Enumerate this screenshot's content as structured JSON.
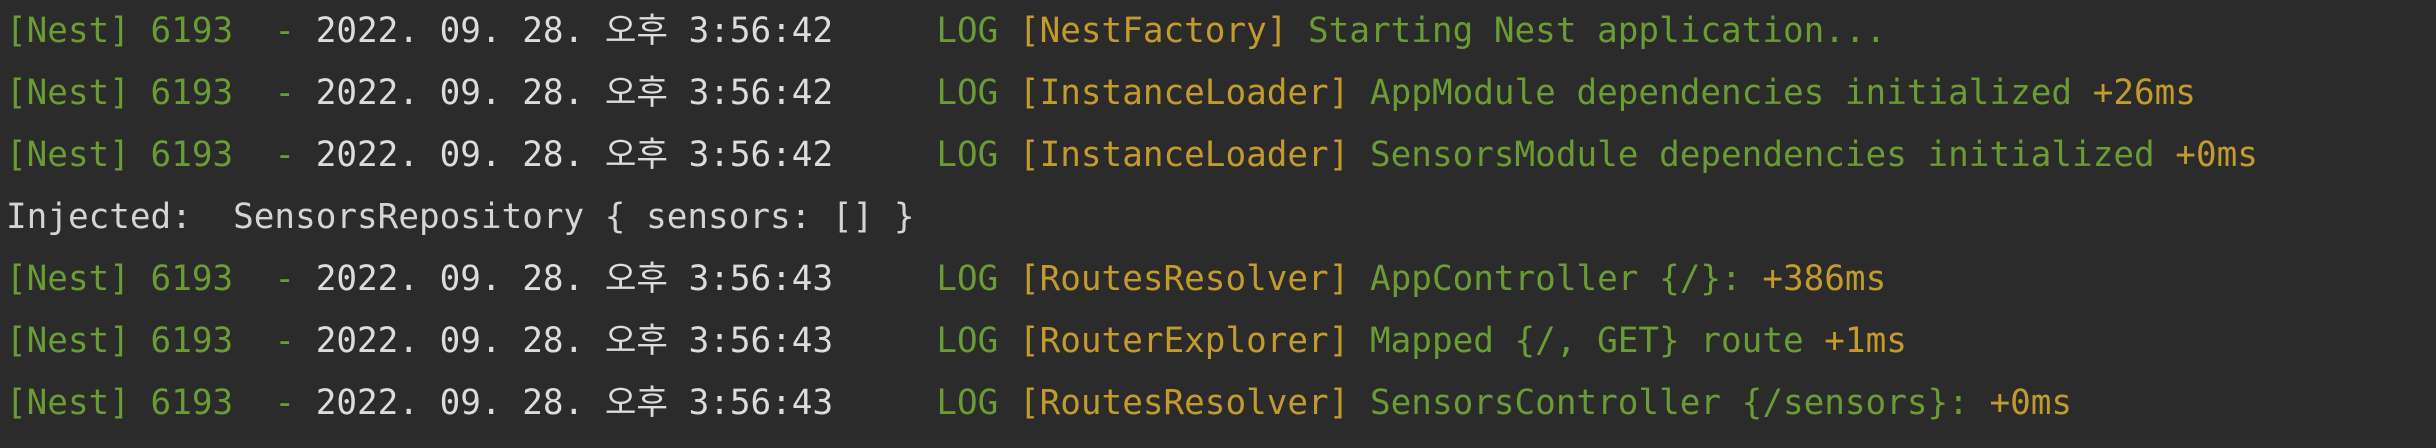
{
  "colors": {
    "background": "#2b2b2b",
    "prefix_green": "#6a9b35",
    "timestamp_grey": "#dcdcdc",
    "context_gold": "#c39a2e",
    "plain_text": "#d4d4d4"
  },
  "lines": [
    {
      "type": "log",
      "prefix": "[Nest] 6193  - ",
      "timestamp": "2022. 09. 28. 오후 3:56:42",
      "level": "     LOG ",
      "context": "[NestFactory]",
      "message": " Starting Nest application..."
    },
    {
      "type": "log",
      "prefix": "[Nest] 6193  - ",
      "timestamp": "2022. 09. 28. 오후 3:56:42",
      "level": "     LOG ",
      "context": "[InstanceLoader]",
      "message": " AppModule dependencies initialized",
      "timing": " +26ms"
    },
    {
      "type": "log",
      "prefix": "[Nest] 6193  - ",
      "timestamp": "2022. 09. 28. 오후 3:56:42",
      "level": "     LOG ",
      "context": "[InstanceLoader]",
      "message": " SensorsModule dependencies initialized",
      "timing": " +0ms"
    },
    {
      "type": "plain",
      "text": "Injected:  SensorsRepository { sensors: [] }"
    },
    {
      "type": "log",
      "prefix": "[Nest] 6193  - ",
      "timestamp": "2022. 09. 28. 오후 3:56:43",
      "level": "     LOG ",
      "context": "[RoutesResolver]",
      "message": " AppController {/}:",
      "timing": " +386ms"
    },
    {
      "type": "log",
      "prefix": "[Nest] 6193  - ",
      "timestamp": "2022. 09. 28. 오후 3:56:43",
      "level": "     LOG ",
      "context": "[RouterExplorer]",
      "message": " Mapped {/, GET} route",
      "timing": " +1ms"
    },
    {
      "type": "log",
      "prefix": "[Nest] 6193  - ",
      "timestamp": "2022. 09. 28. 오후 3:56:43",
      "level": "     LOG ",
      "context": "[RoutesResolver]",
      "message": " SensorsController {/sensors}:",
      "timing": " +0ms"
    }
  ]
}
